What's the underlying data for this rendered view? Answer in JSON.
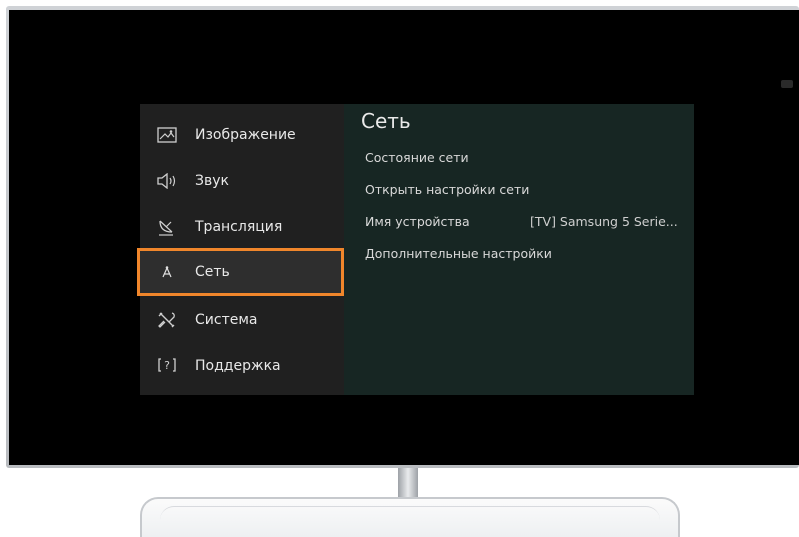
{
  "sidebar": {
    "items": [
      {
        "label": "Изображение",
        "icon": "picture-icon"
      },
      {
        "label": "Звук",
        "icon": "speaker-icon"
      },
      {
        "label": "Трансляция",
        "icon": "satellite-dish-icon"
      },
      {
        "label": "Сеть",
        "icon": "network-icon",
        "selected": true
      },
      {
        "label": "Система",
        "icon": "tools-icon"
      },
      {
        "label": "Поддержка",
        "icon": "support-icon"
      }
    ]
  },
  "panel": {
    "title": "Сеть",
    "items": [
      {
        "label": "Состояние сети"
      },
      {
        "label": "Открыть настройки сети"
      },
      {
        "label": "Имя устройства",
        "value": "[TV] Samsung 5 Serie..."
      },
      {
        "label": "Дополнительные настройки"
      }
    ]
  },
  "colors": {
    "selection_border": "#f0862b",
    "sidebar_bg": "#202020",
    "panel_bg": "#172623"
  }
}
